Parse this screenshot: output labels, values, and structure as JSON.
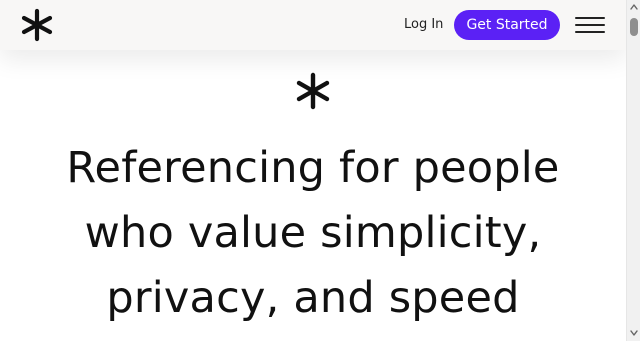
{
  "header": {
    "logo_icon": "asterisk-logo-icon",
    "login_label": "Log In",
    "get_started_label": "Get Started",
    "menu_icon": "hamburger-menu-icon",
    "background_color": "#f8f7f6"
  },
  "hero": {
    "mark_icon": "asterisk-icon",
    "title_lines": [
      "Referencing for people",
      "who value simplicity,",
      "privacy, and speed"
    ]
  },
  "scrollbar": {
    "up_icon": "scroll-up-arrow-icon",
    "down_icon": "scroll-down-arrow-icon"
  },
  "colors": {
    "accent": "#5b21f5",
    "text": "#111111",
    "page_background": "#ffffff"
  }
}
